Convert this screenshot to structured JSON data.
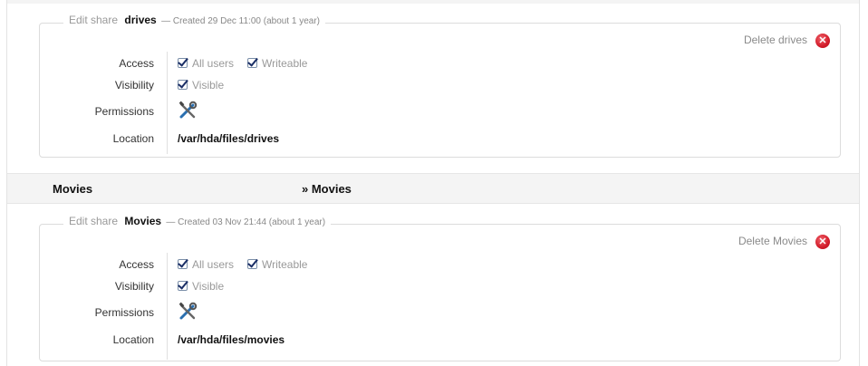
{
  "shares": [
    {
      "edit_label": "Edit share",
      "name": "drives",
      "created": "— Created 29 Dec 11:00 (about 1 year)",
      "delete_label": "Delete drives",
      "fields": {
        "access_label": "Access",
        "visibility_label": "Visibility",
        "permissions_label": "Permissions",
        "location_label": "Location"
      },
      "access": [
        {
          "label": "All users",
          "checked": true
        },
        {
          "label": "Writeable",
          "checked": true
        }
      ],
      "visibility": {
        "label": "Visible",
        "checked": true
      },
      "permissions_icon": "tools-icon",
      "location": "/var/hda/files/drives"
    },
    {
      "edit_label": "Edit share",
      "name": "Movies",
      "created": "— Created 03 Nov 21:44 (about 1 year)",
      "delete_label": "Delete Movies",
      "fields": {
        "access_label": "Access",
        "visibility_label": "Visibility",
        "permissions_label": "Permissions",
        "location_label": "Location"
      },
      "access": [
        {
          "label": "All users",
          "checked": true
        },
        {
          "label": "Writeable",
          "checked": true
        }
      ],
      "visibility": {
        "label": "Visible",
        "checked": true
      },
      "permissions_icon": "tools-icon",
      "location": "/var/hda/files/movies"
    }
  ],
  "section_header": {
    "title": "Movies",
    "path": "» Movies"
  },
  "colors": {
    "delete_icon": "#d21c2a",
    "header_bg": "#f4f4f4"
  }
}
